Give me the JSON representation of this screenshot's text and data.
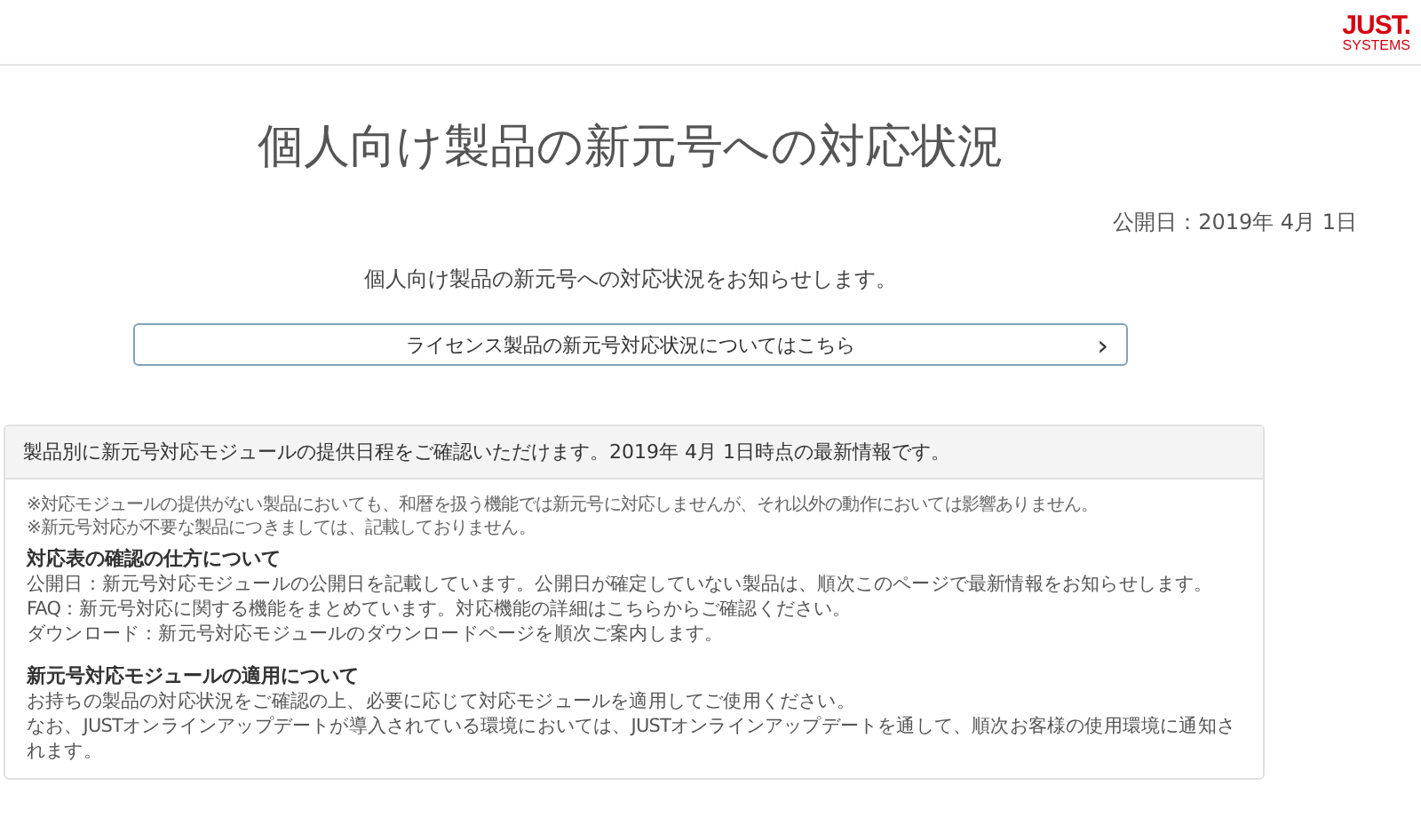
{
  "header": {
    "logo": {
      "main": "JUST.",
      "sub": "SYSTEMS"
    }
  },
  "title": "個人向け製品の新元号への対応状況",
  "published": "公開日：2019年 4月 1日",
  "intro": "個人向け製品の新元号への対応状況をお知らせします。",
  "link_button": {
    "label": "ライセンス製品の新元号対応状況についてはこちら",
    "arrow": "›"
  },
  "panel": {
    "heading": "製品別に新元号対応モジュールの提供日程をご確認いただけます。2019年 4月 1日時点の最新情報です。",
    "notes": [
      "※対応モジュールの提供がない製品においても、和暦を扱う機能では新元号に対応しませんが、それ以外の動作においては影響ありません。",
      "※新元号対応が不要な製品につきましては、記載しておりません。"
    ],
    "sections": [
      {
        "title": "対応表の確認の仕方について",
        "lines": [
          "公開日：新元号対応モジュールの公開日を記載しています。公開日が確定していない製品は、順次このページで最新情報をお知らせします。",
          "FAQ：新元号対応に関する機能をまとめています。対応機能の詳細はこちらからご確認ください。",
          "ダウンロード：新元号対応モジュールのダウンロードページを順次ご案内します。"
        ]
      },
      {
        "title": "新元号対応モジュールの適用について",
        "lines": [
          "お持ちの製品の対応状況をご確認の上、必要に応じて対応モジュールを適用してご使用ください。",
          "なお、JUSTオンラインアップデートが導入されている環境においては、JUSTオンラインアップデートを通して、順次お客様の使用環境に通知されます。"
        ]
      }
    ]
  }
}
